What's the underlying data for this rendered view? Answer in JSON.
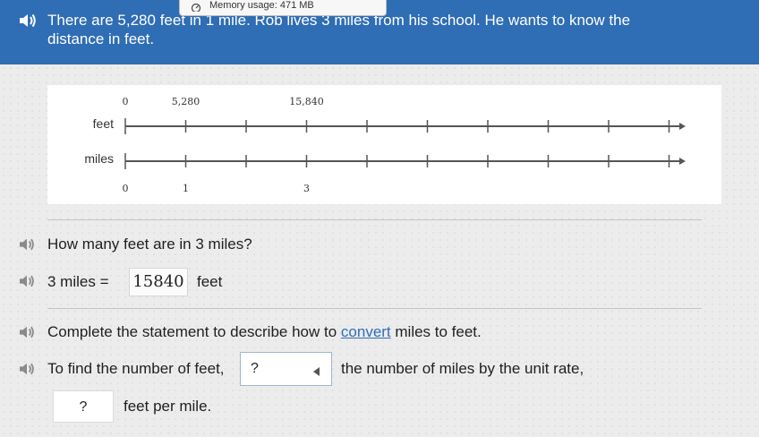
{
  "header": {
    "line1": "There are 5,280 feet in 1 mile. Rob lives 3 miles from his school. He wants to know the",
    "line2": "distance in feet."
  },
  "tooltip": {
    "label": "Memory usage: 471 MB"
  },
  "number_line": {
    "feet_label": "feet",
    "miles_label": "miles",
    "feet_ticks": [
      "0",
      "5,280",
      "",
      "15,840",
      "",
      "",
      "",
      "",
      "",
      ""
    ],
    "miles_ticks": [
      "0",
      "1",
      "",
      "3",
      "",
      "",
      "",
      "",
      "",
      ""
    ]
  },
  "question1": {
    "text": "How many feet are in 3 miles?"
  },
  "equation": {
    "left": "3 miles =",
    "value": "15840",
    "unit": "feet"
  },
  "question2": {
    "before": "Complete the statement to describe how to ",
    "link": "convert",
    "after": " miles to feet."
  },
  "statement": {
    "start": "To find the number of feet,",
    "select_value": "?",
    "middle": "the number of miles by the unit rate,",
    "answer_value": "?",
    "end": "feet per mile."
  },
  "colors": {
    "header_bg": "#2f6db5",
    "link": "#2f6db5"
  }
}
